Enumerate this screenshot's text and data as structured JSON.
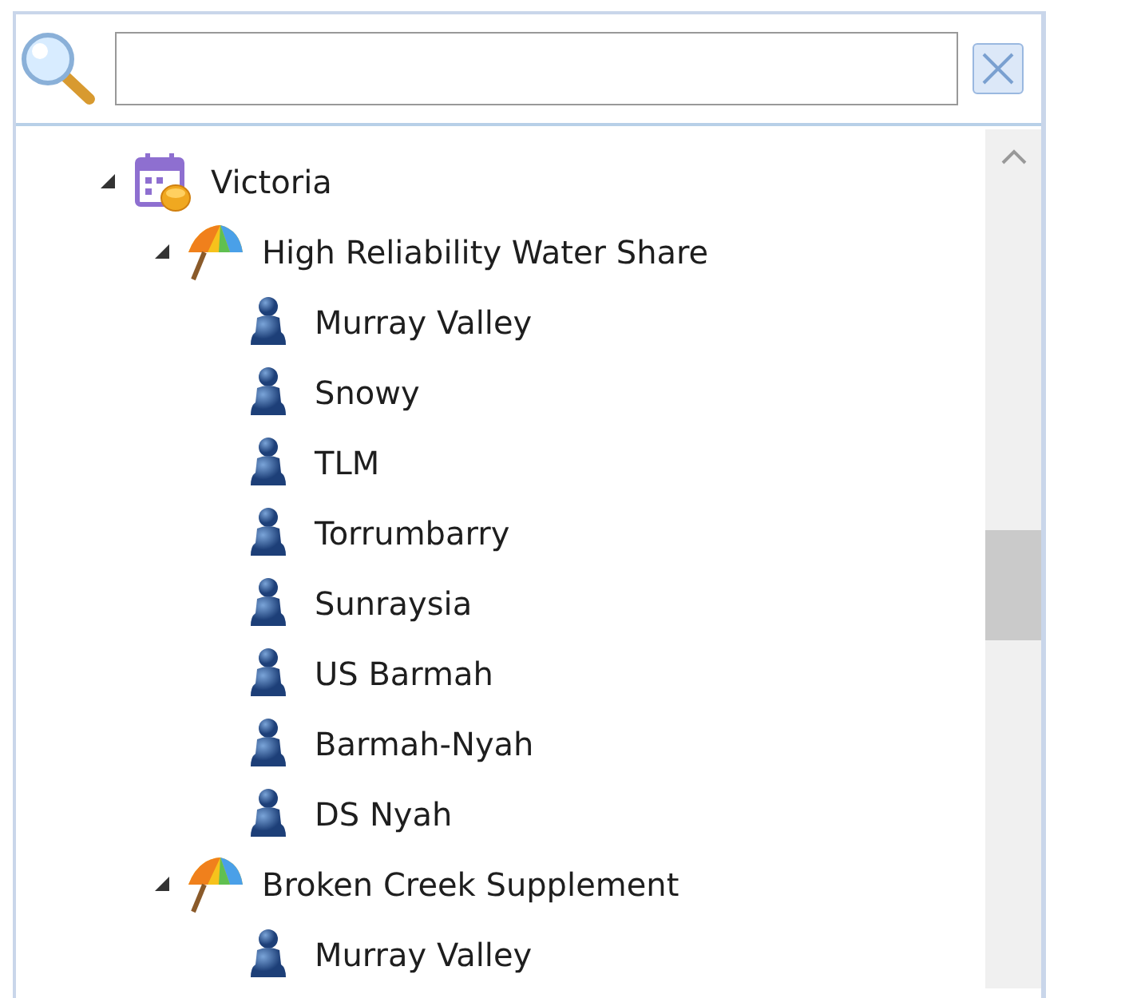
{
  "tree": [
    {
      "label": "Victoria",
      "kind": "calendar",
      "expanded": true,
      "children": [
        {
          "label": "High Reliability Water Share",
          "kind": "umbrella",
          "expanded": true,
          "children": [
            {
              "label": "Murray Valley",
              "kind": "person"
            },
            {
              "label": "Snowy",
              "kind": "person"
            },
            {
              "label": "TLM",
              "kind": "person"
            },
            {
              "label": "Torrumbarry",
              "kind": "person"
            },
            {
              "label": "Sunraysia",
              "kind": "person"
            },
            {
              "label": "US Barmah",
              "kind": "person"
            },
            {
              "label": "Barmah-Nyah",
              "kind": "person"
            },
            {
              "label": "DS Nyah",
              "kind": "person"
            }
          ]
        },
        {
          "label": "Broken Creek Supplement",
          "kind": "umbrella",
          "expanded": true,
          "children": [
            {
              "label": "Murray Valley",
              "kind": "person"
            }
          ]
        }
      ]
    }
  ]
}
